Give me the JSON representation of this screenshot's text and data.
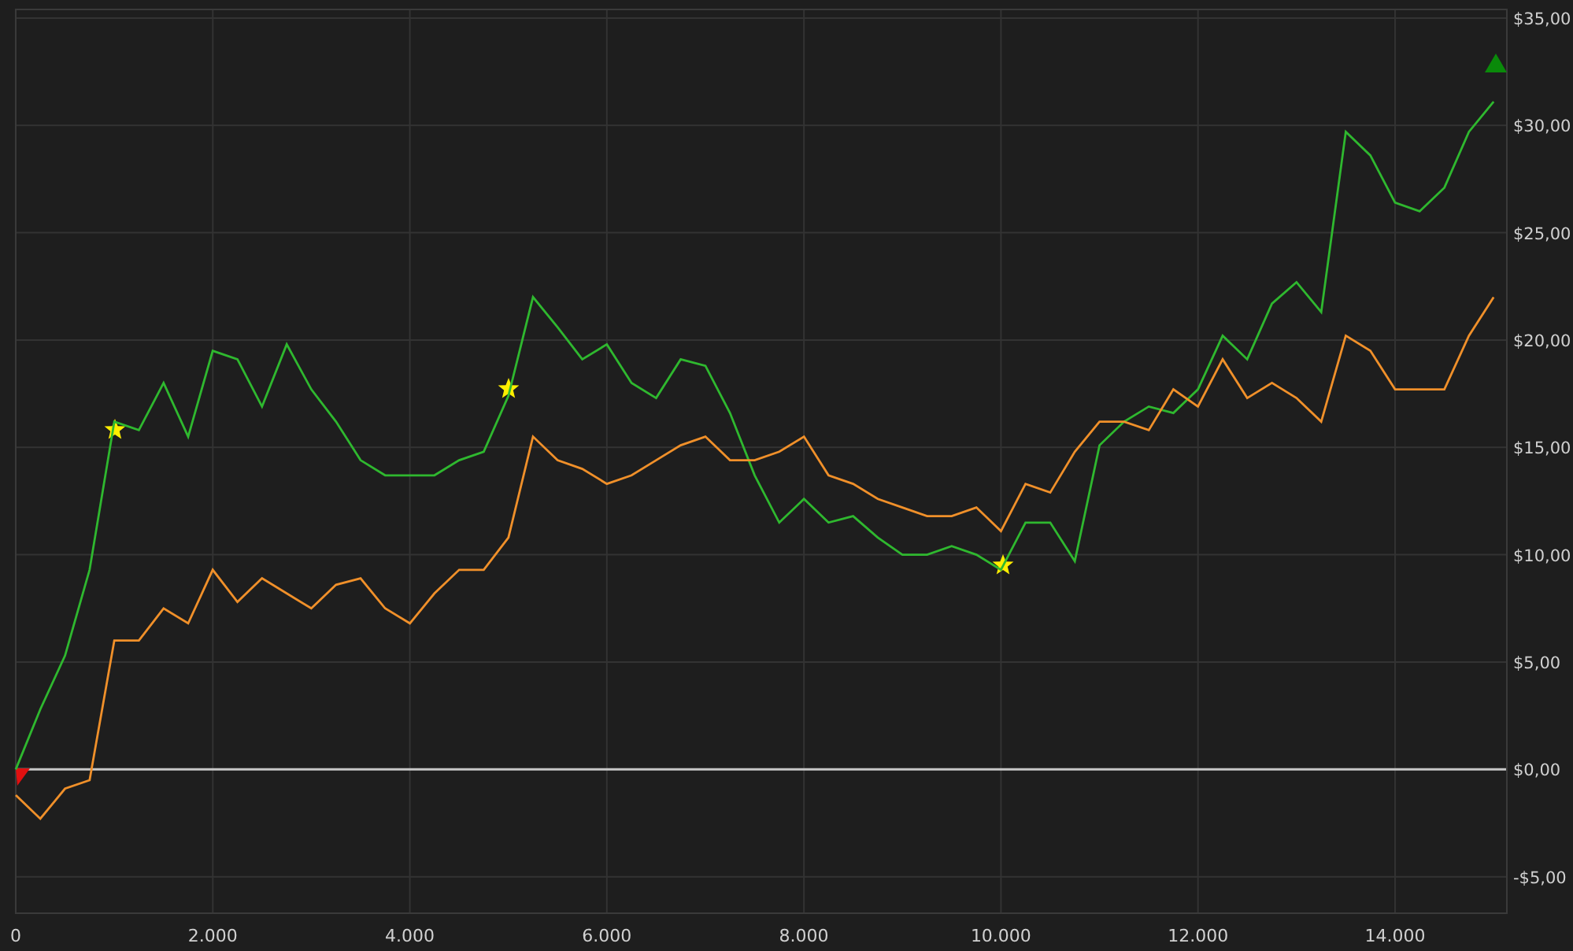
{
  "chart_data": {
    "type": "line",
    "x": [
      0,
      250,
      500,
      750,
      1000,
      1250,
      1500,
      1750,
      2000,
      2250,
      2500,
      2750,
      3000,
      3250,
      3500,
      3750,
      4000,
      4250,
      4500,
      4750,
      5000,
      5250,
      5500,
      5750,
      6000,
      6250,
      6500,
      6750,
      7000,
      7250,
      7500,
      7750,
      8000,
      8250,
      8500,
      8750,
      9000,
      9250,
      9500,
      9750,
      10000,
      10250,
      10500,
      10750,
      11000,
      11250,
      11500,
      11750,
      12000,
      12250,
      12500,
      12750,
      13000,
      13250,
      13500,
      13750,
      14000,
      14250,
      14500,
      14750,
      15000
    ],
    "series": [
      {
        "color": "#2fb82f",
        "values": [
          0,
          2.8,
          5.3,
          9.3,
          16.2,
          15.8,
          18,
          15.5,
          19.5,
          19.1,
          16.9,
          19.8,
          17.7,
          16.2,
          14.4,
          13.7,
          13.7,
          13.7,
          14.4,
          14.8,
          17.4,
          22,
          20.6,
          19.1,
          19.8,
          18,
          17.3,
          19.1,
          18.8,
          16.6,
          13.7,
          11.5,
          12.6,
          11.5,
          11.8,
          10.8,
          10,
          10,
          10.4,
          10,
          9.3,
          11.5,
          11.5,
          9.7,
          15.1,
          16.2,
          16.9,
          16.6,
          17.7,
          20.2,
          19.1,
          21.7,
          22.7,
          21.3,
          29.7,
          28.6,
          26.4,
          26,
          27.1,
          29.7,
          31.1
        ]
      },
      {
        "color": "#f0902a",
        "values": [
          -1.2,
          -2.3,
          -0.9,
          -0.5,
          6,
          6,
          7.5,
          6.8,
          9.3,
          7.8,
          8.9,
          8.2,
          7.5,
          8.6,
          8.9,
          7.5,
          6.8,
          8.2,
          9.3,
          9.3,
          10.8,
          15.5,
          14.4,
          14,
          13.3,
          13.7,
          14.4,
          15.1,
          15.5,
          14.4,
          14.4,
          14.8,
          15.5,
          13.7,
          13.3,
          12.6,
          12.2,
          11.8,
          11.8,
          12.2,
          11.1,
          13.3,
          12.9,
          14.8,
          16.2,
          16.2,
          15.8,
          17.7,
          16.9,
          19.1,
          17.3,
          18,
          17.3,
          16.2,
          20.2,
          19.5,
          17.7,
          17.7,
          17.7,
          20.2,
          22
        ]
      }
    ],
    "xlim": [
      0,
      15135
    ],
    "ylim": [
      -6.7,
      35.4
    ],
    "xticks": [
      {
        "value": 0,
        "label": "0"
      },
      {
        "value": 2000,
        "label": "2.000"
      },
      {
        "value": 4000,
        "label": "4.000"
      },
      {
        "value": 6000,
        "label": "6.000"
      },
      {
        "value": 8000,
        "label": "8.000"
      },
      {
        "value": 10000,
        "label": "10.000"
      },
      {
        "value": 12000,
        "label": "12.000"
      },
      {
        "value": 14000,
        "label": "14.000"
      }
    ],
    "yticks": [
      {
        "value": -5,
        "label": "-$5,00"
      },
      {
        "value": 0,
        "label": "$0,00"
      },
      {
        "value": 5,
        "label": "$5,00"
      },
      {
        "value": 10,
        "label": "$10,00"
      },
      {
        "value": 15,
        "label": "$15,00"
      },
      {
        "value": 20,
        "label": "$20,00"
      },
      {
        "value": 25,
        "label": "$25,00"
      },
      {
        "value": 30,
        "label": "$30,00"
      },
      {
        "value": 35,
        "label": "$35,00"
      }
    ],
    "grid": true
  },
  "markers": [
    {
      "kind": "star"
    },
    {
      "kind": "star"
    },
    {
      "kind": "star"
    },
    {
      "kind": "down"
    },
    {
      "kind": "up"
    }
  ]
}
